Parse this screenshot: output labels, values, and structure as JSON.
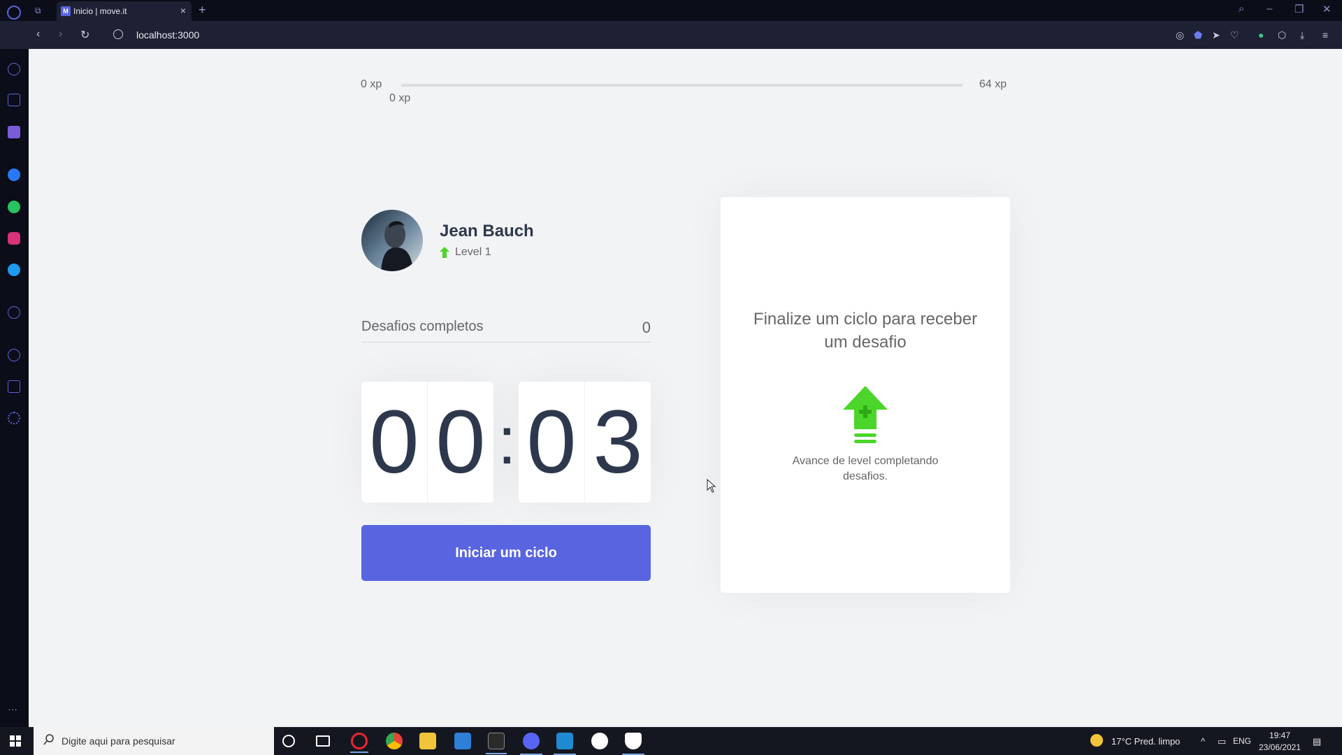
{
  "browser": {
    "tab_title": "Inicio | move.it",
    "tab_favicon": "M",
    "url": "localhost:3000",
    "new_tab_label": "+",
    "close_tab_label": "×"
  },
  "xp": {
    "start": "0 xp",
    "current": "0 xp",
    "end": "64 xp",
    "progress_fraction": 0
  },
  "profile": {
    "name": "Jean Bauch",
    "level": "Level 1"
  },
  "challenges": {
    "label": "Desafios completos",
    "count": "0"
  },
  "countdown": {
    "minute_tens": "0",
    "minute_units": "0",
    "separator": ":",
    "second_tens": "0",
    "second_units": "3"
  },
  "start_button": {
    "label": "Iniciar um ciclo"
  },
  "challenge_card": {
    "title": "Finalize um ciclo para receber um desafio",
    "text": "Avance de level completando desafios.",
    "icon": "level-up-icon"
  },
  "taskbar": {
    "search_placeholder": "Digite aqui para pesquisar",
    "weather": "17°C  Pred. limpo",
    "language": "ENG",
    "time": "19:47",
    "date": "23/06/2021"
  },
  "colors": {
    "accent": "#5965e0",
    "green": "#4cd62b",
    "title": "#2e384d",
    "text": "#666666",
    "background": "#f2f3f5"
  }
}
